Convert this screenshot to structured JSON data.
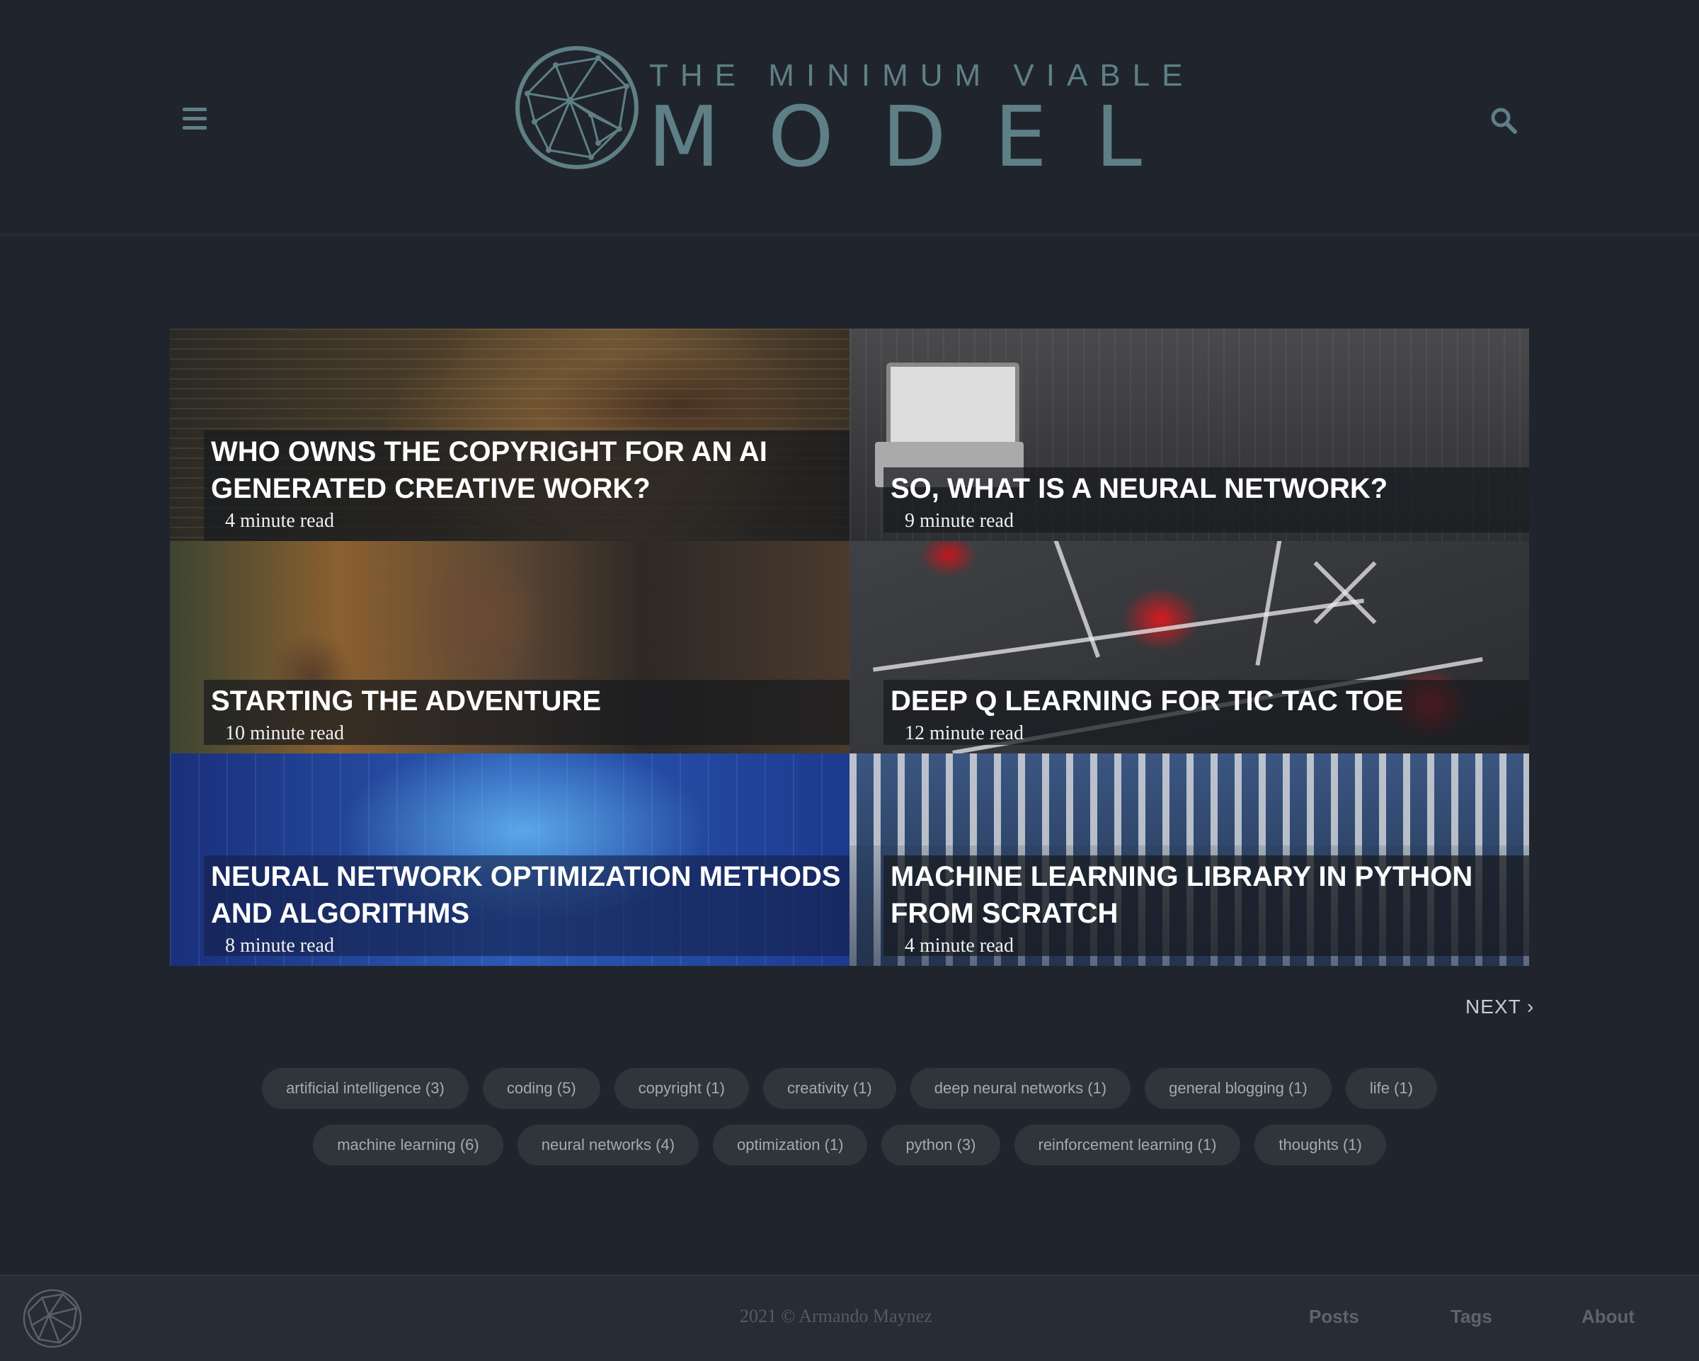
{
  "brand": {
    "top_line": "THE MINIMUM VIABLE",
    "main_word": "MODEL"
  },
  "header": {
    "menu_icon": "hamburger-menu-icon",
    "search_icon": "search-icon"
  },
  "posts": [
    {
      "title": "WHO OWNS THE COPYRIGHT FOR AN AI GENERATED CREATIVE WORK?",
      "read_time": "4 minute read"
    },
    {
      "title": "SO, WHAT IS A NEURAL NETWORK?",
      "read_time": "9 minute read"
    },
    {
      "title": "STARTING THE ADVENTURE",
      "read_time": "10 minute read"
    },
    {
      "title": "DEEP Q LEARNING FOR TIC TAC TOE",
      "read_time": "12 minute read"
    },
    {
      "title": "NEURAL NETWORK OPTIMIZATION METHODS AND ALGORITHMS",
      "read_time": "8 minute read"
    },
    {
      "title": "MACHINE LEARNING LIBRARY IN PYTHON FROM SCRATCH",
      "read_time": "4 minute read"
    }
  ],
  "pagination": {
    "next_label": "NEXT"
  },
  "tags": {
    "row1": [
      "artificial intelligence (3)",
      "coding (5)",
      "copyright (1)",
      "creativity (1)",
      "deep neural networks (1)",
      "general blogging (1)",
      "life (1)"
    ],
    "row2": [
      "machine learning (6)",
      "neural networks (4)",
      "optimization (1)",
      "python (3)",
      "reinforcement learning (1)",
      "thoughts (1)"
    ]
  },
  "footer": {
    "copyright": "2021 © Armando Maynez",
    "nav": [
      "Posts",
      "Tags",
      "About"
    ]
  },
  "colors": {
    "background": "#20252d",
    "logo": "#5f7f86",
    "footer": "#272d36",
    "tag": "#30343b"
  }
}
